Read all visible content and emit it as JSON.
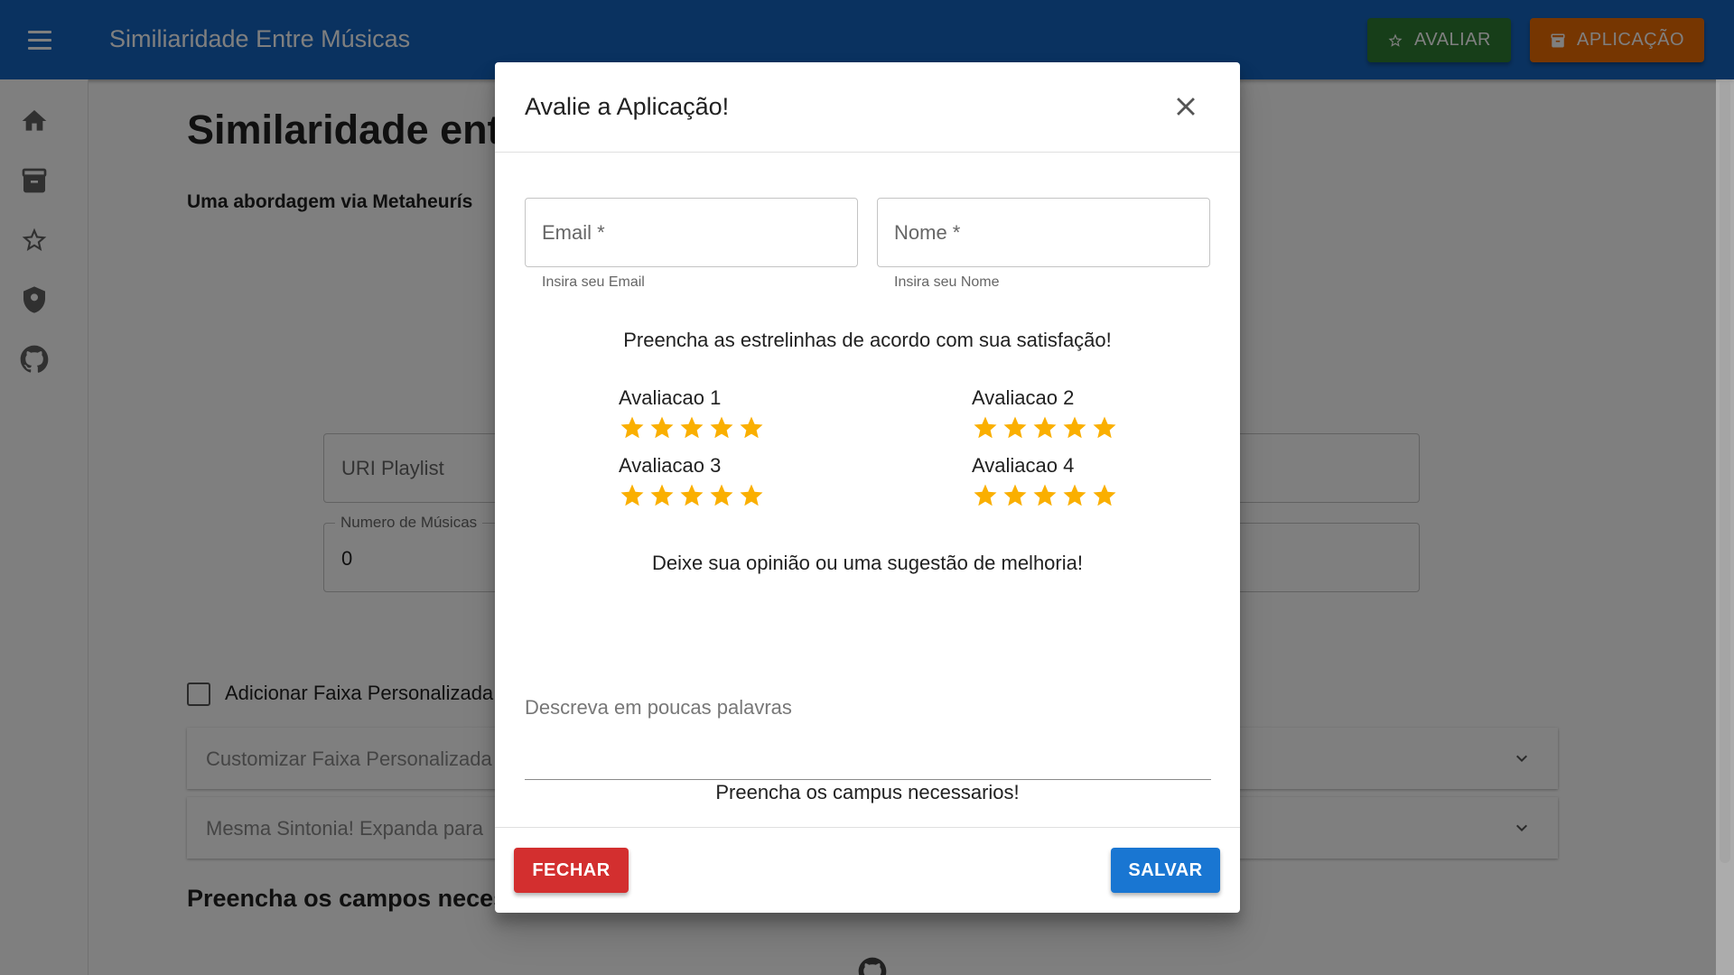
{
  "appbar": {
    "title": "Similiaridade Entre Músicas",
    "avaliar_label": "AVALIAR",
    "aplicacao_label": "APLICAÇÃO",
    "color": "#1565c0"
  },
  "sidebar": {
    "items": [
      "home-icon",
      "archive-icon",
      "star-icon",
      "privacy-icon",
      "github-icon"
    ]
  },
  "page": {
    "heading": "Similaridade ent",
    "subtitle": "Uma abordagem via Metaheurís",
    "uri_placeholder": "URI Playlist",
    "num_label": "Numero de Músicas",
    "num_value": "0",
    "checkbox_label": "Adicionar Faixa Personalizada",
    "accordion1": "Customizar Faixa Personalizada",
    "accordion2": "Mesma Sintonia! Expanda para",
    "bottom_text": "Preencha os campos neces"
  },
  "dialog": {
    "title": "Avalie a Aplicação!",
    "email_placeholder": "Email *",
    "email_helper": "Insira seu Email",
    "nome_placeholder": "Nome *",
    "nome_helper": "Insira seu Nome",
    "stars_prompt": "Preencha as estrelinhas de acordo com sua satisfação!",
    "ratings": [
      {
        "label": "Avaliacao 1",
        "value": 5,
        "max": 5
      },
      {
        "label": "Avaliacao 2",
        "value": 5,
        "max": 5
      },
      {
        "label": "Avaliacao 3",
        "value": 5,
        "max": 5
      },
      {
        "label": "Avaliacao 4",
        "value": 5,
        "max": 5
      }
    ],
    "opinion_prompt": "Deixe sua opinião ou uma sugestão de melhoria!",
    "textarea_placeholder": "Descreva em poucas palavras",
    "required_msg": "Preencha os campus necessarios!",
    "fechar_label": "FECHAR",
    "salvar_label": "SALVAR"
  },
  "colors": {
    "star": "#faaf00",
    "fechar": "#d32f2f",
    "salvar": "#1976d2",
    "avaliar": "#2e7d32",
    "aplicacao": "#ed6c02"
  }
}
